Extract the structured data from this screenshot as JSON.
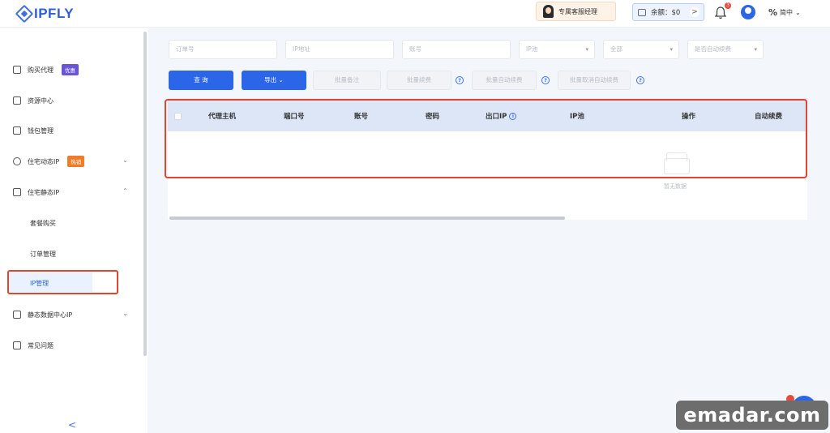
{
  "header": {
    "logo_text": "IPFLY",
    "manager_label": "专属客服经理",
    "balance_label": "余额：$0",
    "balance_arrow": ">",
    "notification_count": "3",
    "language": "简中"
  },
  "sidebar": {
    "items": [
      {
        "label": "购买代理",
        "tag": "优惠",
        "icon": "cart-icon"
      },
      {
        "label": "资源中心",
        "icon": "grid-icon"
      },
      {
        "label": "钱包管理",
        "icon": "wallet-icon"
      },
      {
        "label": "住宅动态IP",
        "tag": "热销",
        "icon": "globe-icon",
        "chevron": "⌄"
      },
      {
        "label": "住宅静态IP",
        "icon": "home-icon",
        "chevron": "⌃"
      }
    ],
    "sub_items": [
      "套餐购买",
      "订单管理",
      "IP管理"
    ],
    "lower_items": [
      {
        "label": "静态数据中心IP",
        "icon": "server-icon",
        "chevron": "⌄"
      },
      {
        "label": "常见问题",
        "icon": "question-icon"
      }
    ],
    "collapse_glyph": "<"
  },
  "filters": {
    "order_no": "订单号",
    "ip_address": "IP地址",
    "account": "账号",
    "ip_pool": "IP池",
    "all": "全部",
    "auto_renew": "是否自动续费"
  },
  "actions": {
    "query": "查 询",
    "export": "导出 ⌄",
    "batch_remark": "批量备注",
    "batch_renew": "批量续费",
    "batch_auto_renew": "批量自动续费",
    "batch_cancel_auto_renew": "批量取消自动续费"
  },
  "table": {
    "columns": [
      "代理主机",
      "端口号",
      "账号",
      "密码",
      "出口IP",
      "IP池",
      "操作",
      "自动续费"
    ],
    "empty_text": "暂无数据"
  },
  "watermark": "emadar.com",
  "colors": {
    "primary": "#2c66e8",
    "highlight": "#e0452f",
    "header_row": "#dde6f7"
  }
}
